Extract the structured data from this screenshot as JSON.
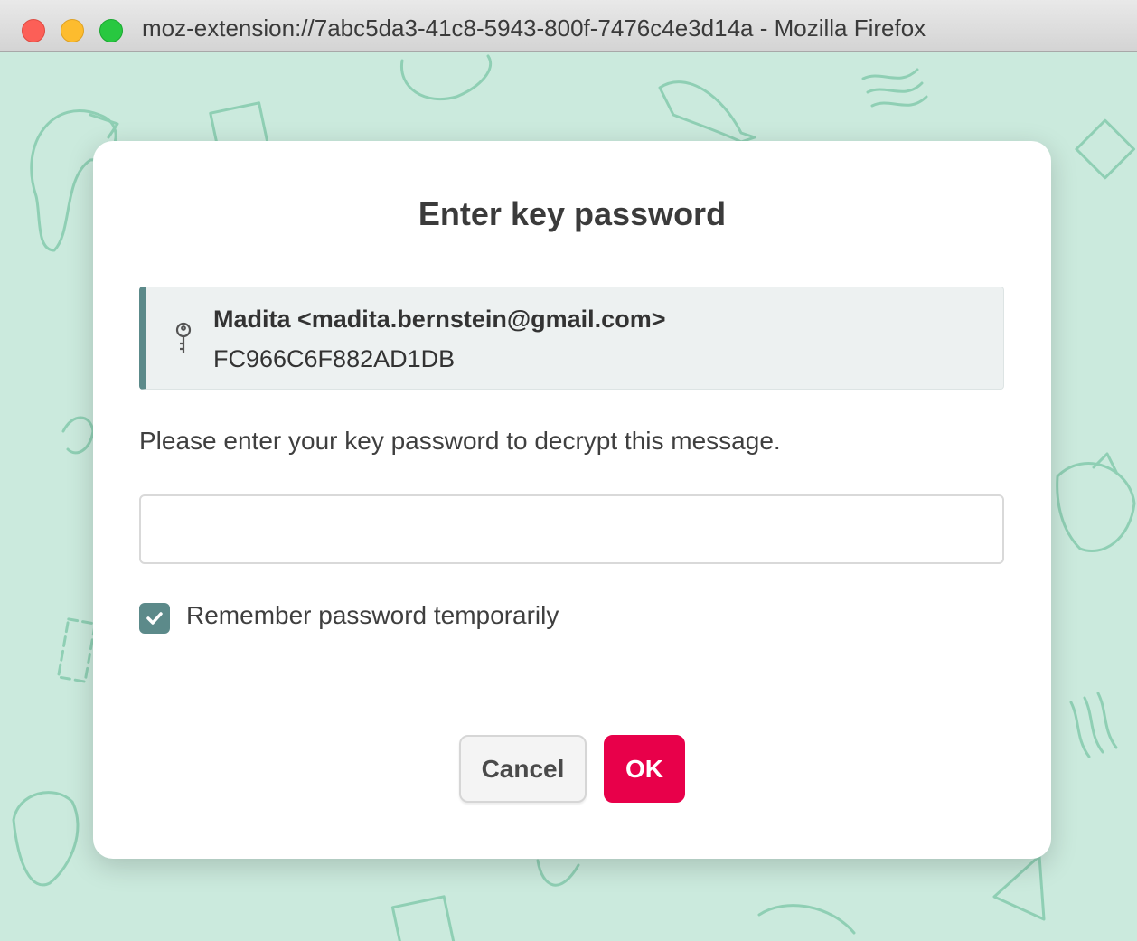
{
  "window": {
    "title": "moz-extension://7abc5da3-41c8-5943-800f-7476c4e3d14a - Mozilla Firefox"
  },
  "dialog": {
    "title": "Enter key password",
    "key": {
      "icon": "key-icon",
      "user": "Madita <madita.bernstein@gmail.com>",
      "key_id": "FC966C6F882AD1DB"
    },
    "prompt": "Please enter your key password to decrypt this message.",
    "password_value": "",
    "remember": {
      "label": "Remember password temporarily",
      "checked": true
    },
    "buttons": {
      "cancel": "Cancel",
      "ok": "OK"
    }
  },
  "colors": {
    "background": "#cbeadd",
    "doodle": "#8fcfb4",
    "accent": "#5c8a8a",
    "ok_button": "#e8004a"
  }
}
